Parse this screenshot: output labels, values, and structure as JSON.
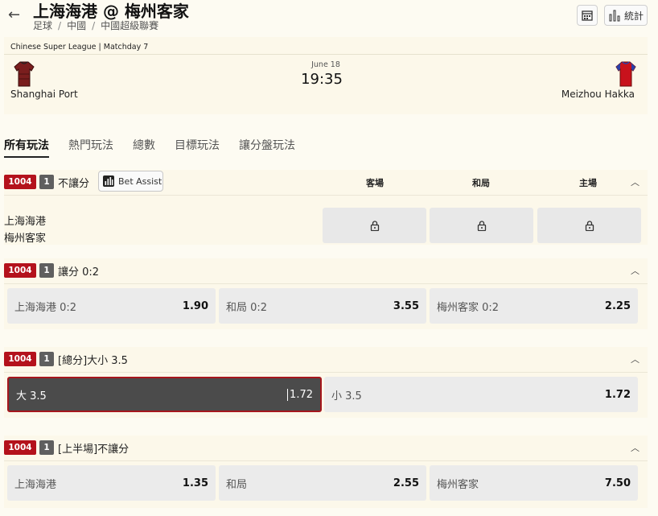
{
  "header": {
    "title": "上海海港 @ 梅州客家",
    "breadcrumbs": [
      "足球",
      "中國",
      "中國超級聯賽"
    ],
    "stats_label": "統計"
  },
  "match": {
    "league_line": "Chinese Super League | Matchday 7",
    "date": "June 18",
    "time": "19:35",
    "home": "Shanghai Port",
    "away": "Meizhou Hakka"
  },
  "tabs": [
    "所有玩法",
    "熱門玩法",
    "總數",
    "目標玩法",
    "讓分盤玩法"
  ],
  "markets": [
    {
      "id": "1004",
      "num": "1",
      "title": "不讓分",
      "bet_assist": "Bet Assist",
      "columns": [
        "客場",
        "和局",
        "主場"
      ],
      "teams": [
        "上海海港",
        "梅州客家"
      ],
      "locked": true
    },
    {
      "id": "1004",
      "num": "1",
      "title": "讓分 0:2",
      "options": [
        {
          "label": "上海海港 0:2",
          "odds": "1.90"
        },
        {
          "label": "和局 0:2",
          "odds": "3.55"
        },
        {
          "label": "梅州客家 0:2",
          "odds": "2.25"
        }
      ]
    },
    {
      "id": "1004",
      "num": "1",
      "title": "[總分]大小 3.5",
      "options": [
        {
          "label": "大 3.5",
          "odds": "1.72"
        },
        {
          "label": "小 3.5",
          "odds": "1.72"
        }
      ]
    },
    {
      "id": "1004",
      "num": "1",
      "title": "[上半場]不讓分",
      "options": [
        {
          "label": "上海海港",
          "odds": "1.35"
        },
        {
          "label": "和局",
          "odds": "2.55"
        },
        {
          "label": "梅州客家",
          "odds": "7.50"
        }
      ]
    }
  ],
  "icons": {
    "back": "arrow-left-icon",
    "calendar": "calendar-icon",
    "stats": "bar-chart-icon",
    "lock": "lock-icon",
    "collapse": "chevron-up-icon"
  },
  "colors": {
    "accent_red": "#b4121c",
    "selected_bg": "#4b4b4b",
    "home_jersey": "#7a1e1e",
    "away_jersey": "#c8121c"
  }
}
